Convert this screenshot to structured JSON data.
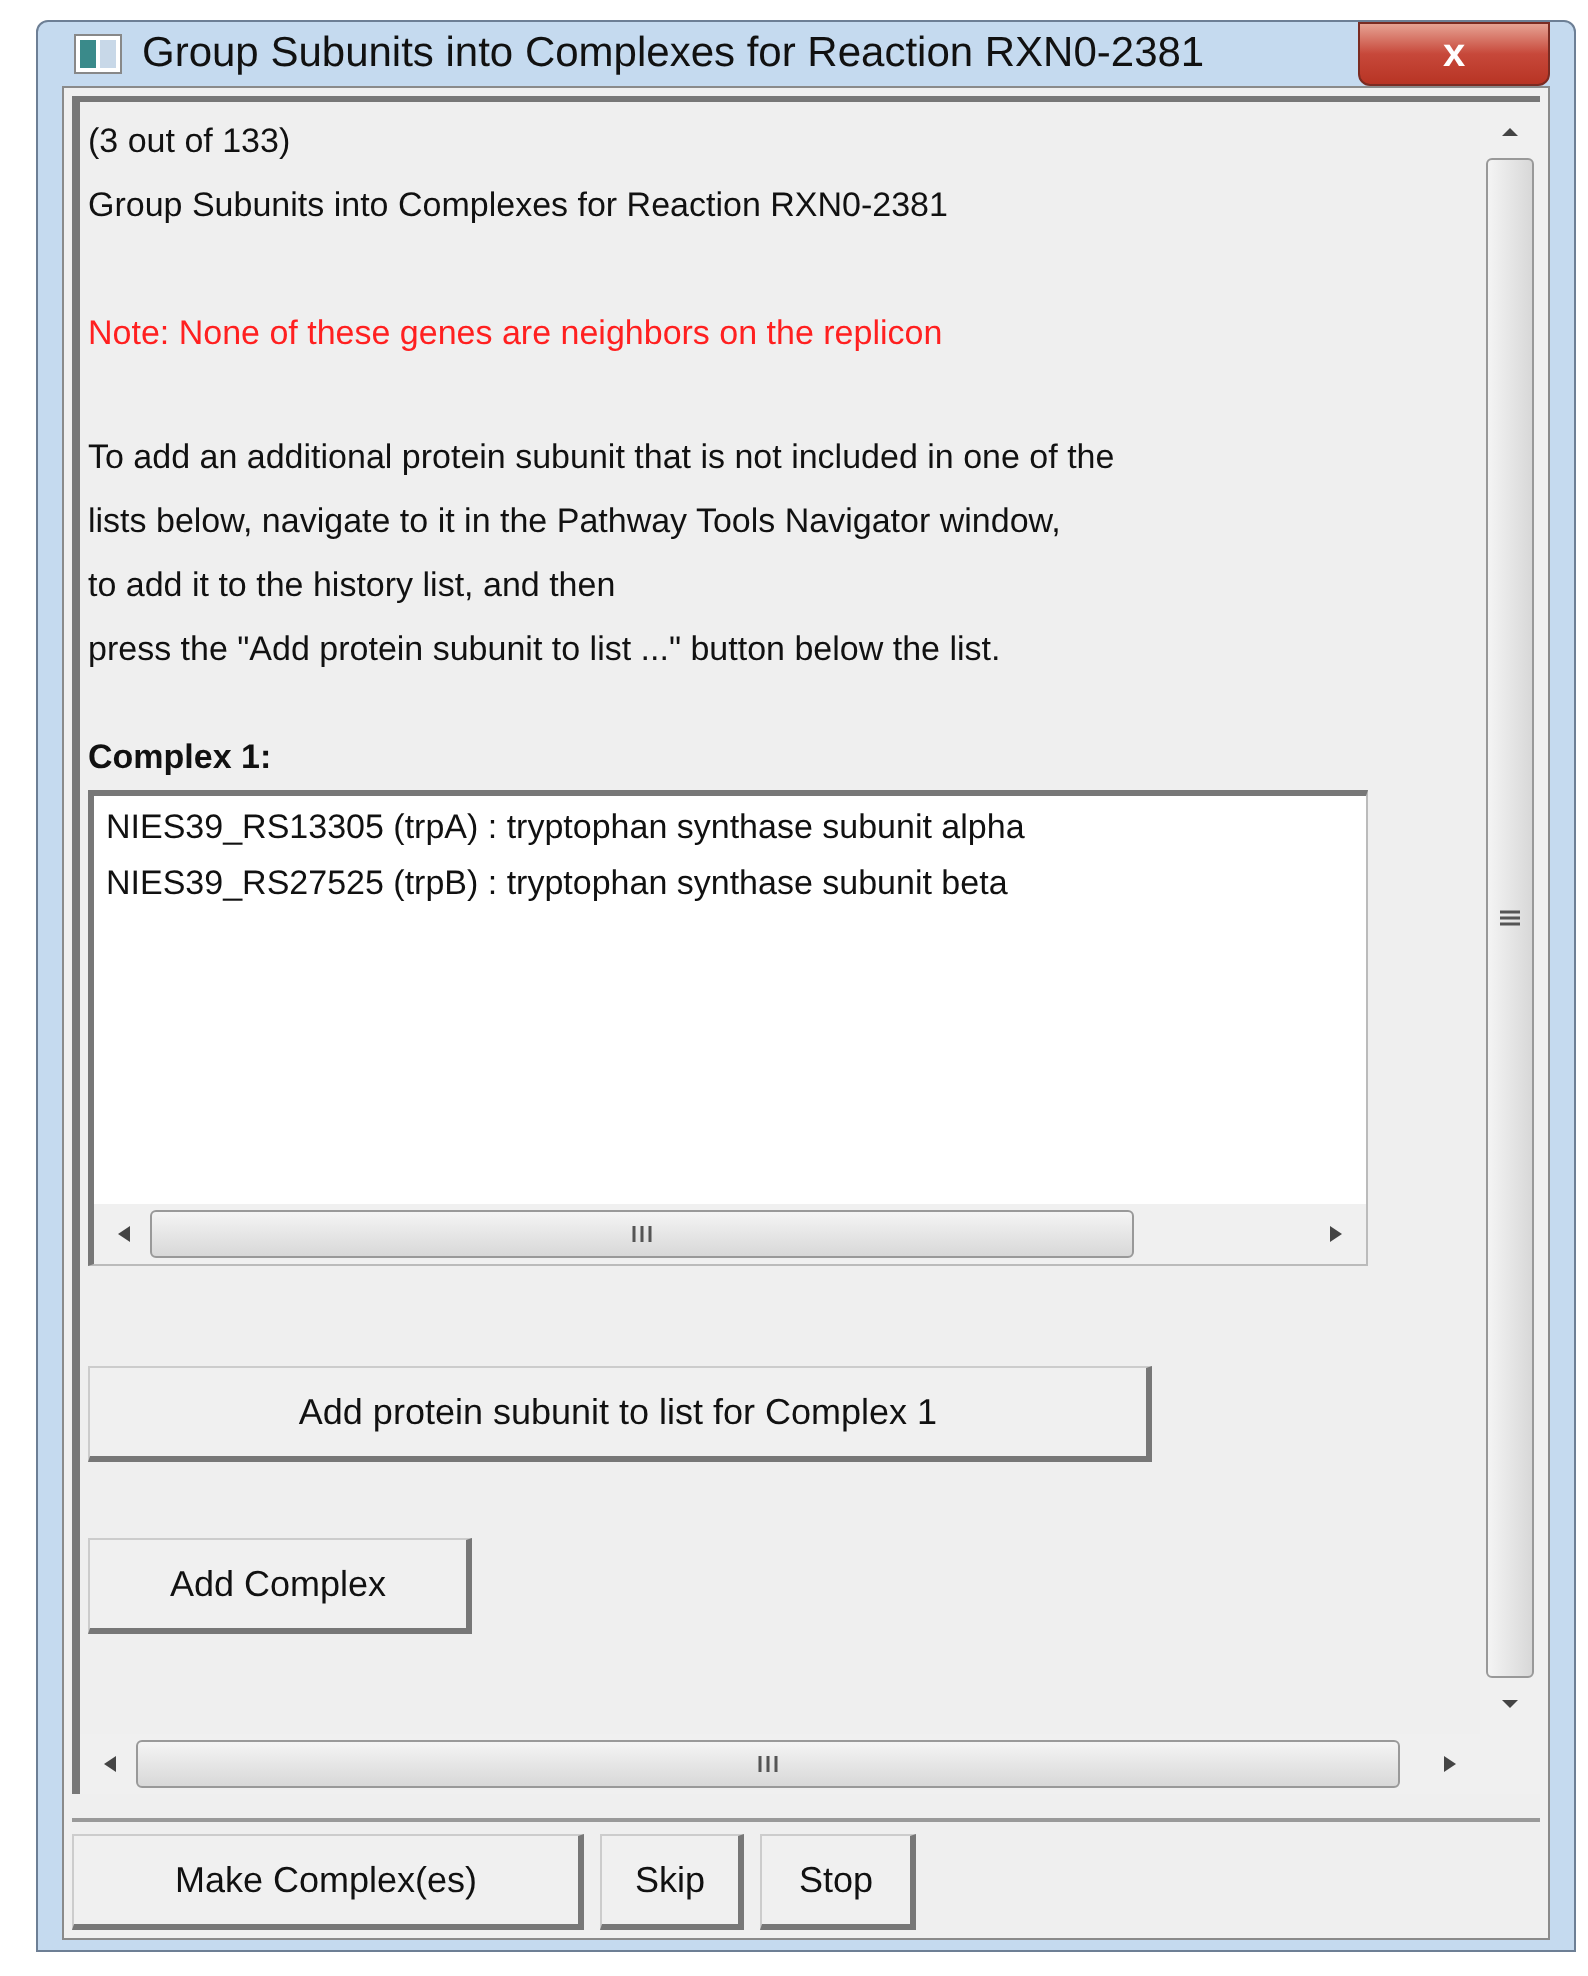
{
  "window": {
    "title": "Group Subunits into Complexes for Reaction RXN0-2381",
    "close_label": "x"
  },
  "messages": [
    {
      "kind": "plain",
      "text": "(3 out of 133)"
    },
    {
      "kind": "plain",
      "text": "Group Subunits into Complexes for Reaction RXN0-2381"
    },
    {
      "kind": "note",
      "text": "Note: None of these genes are neighbors on the replicon"
    }
  ],
  "instructions": [
    "To add an additional protein subunit that is not included in one of the",
    "lists below, navigate to it in the Pathway Tools Navigator window,",
    "to add it to the history list, and then",
    "press the \"Add protein subunit to list ...\" button below the list."
  ],
  "complexes": [
    {
      "label": "Complex 1:",
      "subunits": [
        "NIES39_RS13305 (trpA) : tryptophan synthase subunit alpha",
        "NIES39_RS27525 (trpB) : tryptophan synthase subunit beta"
      ],
      "add_button": "Add protein subunit to list for Complex 1"
    }
  ],
  "add_complex_button": "Add Complex",
  "footer_buttons": [
    "Make Complex(es)",
    "Skip",
    "Stop"
  ]
}
